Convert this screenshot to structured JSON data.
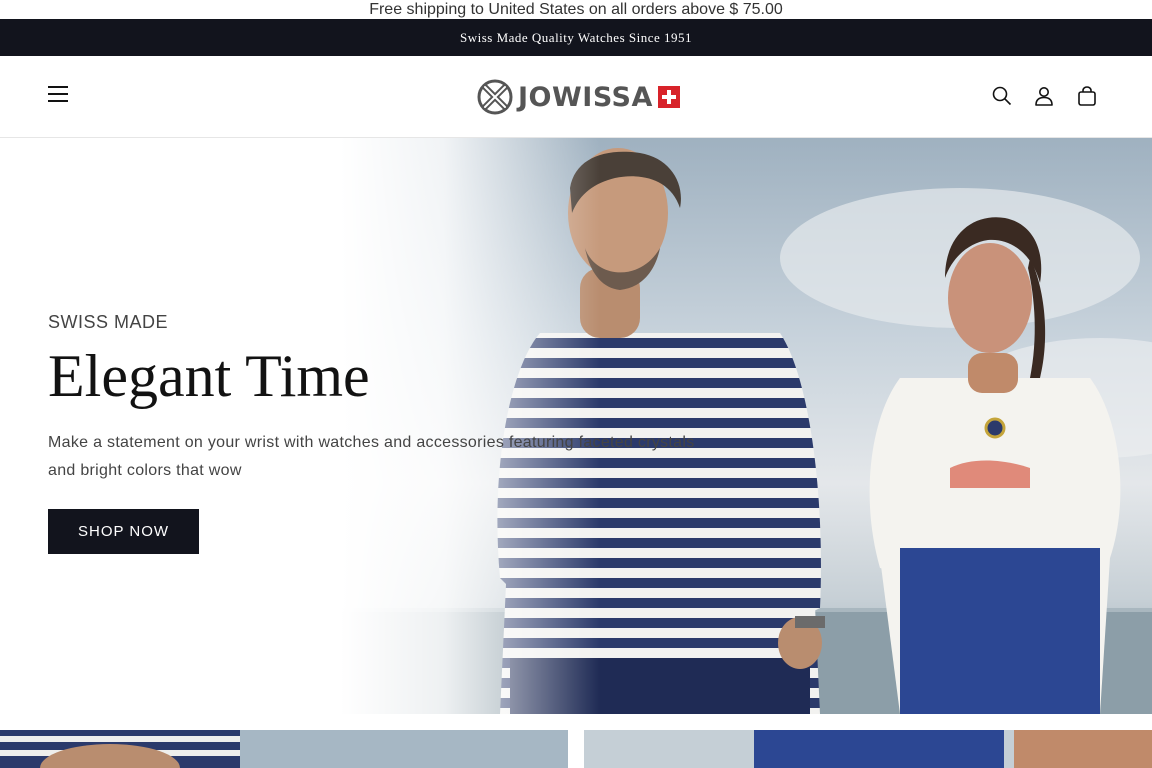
{
  "shipping_bar": {
    "text": "Free shipping to United States on all orders above $ 75.00"
  },
  "announcement": {
    "text": "Swiss Made Quality Watches Since 1951"
  },
  "header": {
    "logo_text": "JOWISSA",
    "icons": {
      "menu": "menu-icon",
      "search": "search-icon",
      "account": "account-icon",
      "cart": "cart-icon"
    }
  },
  "hero": {
    "eyebrow": "SWISS MADE",
    "title": "Elegant Time",
    "description": "Make a statement on your wrist with watches and accessories featuring faceted crystals and bright colors that wow",
    "cta_label": "SHOP NOW"
  },
  "colors": {
    "dark": "#12141d",
    "swiss_red": "#d8232a",
    "stripe_navy": "#2b3a6b"
  }
}
